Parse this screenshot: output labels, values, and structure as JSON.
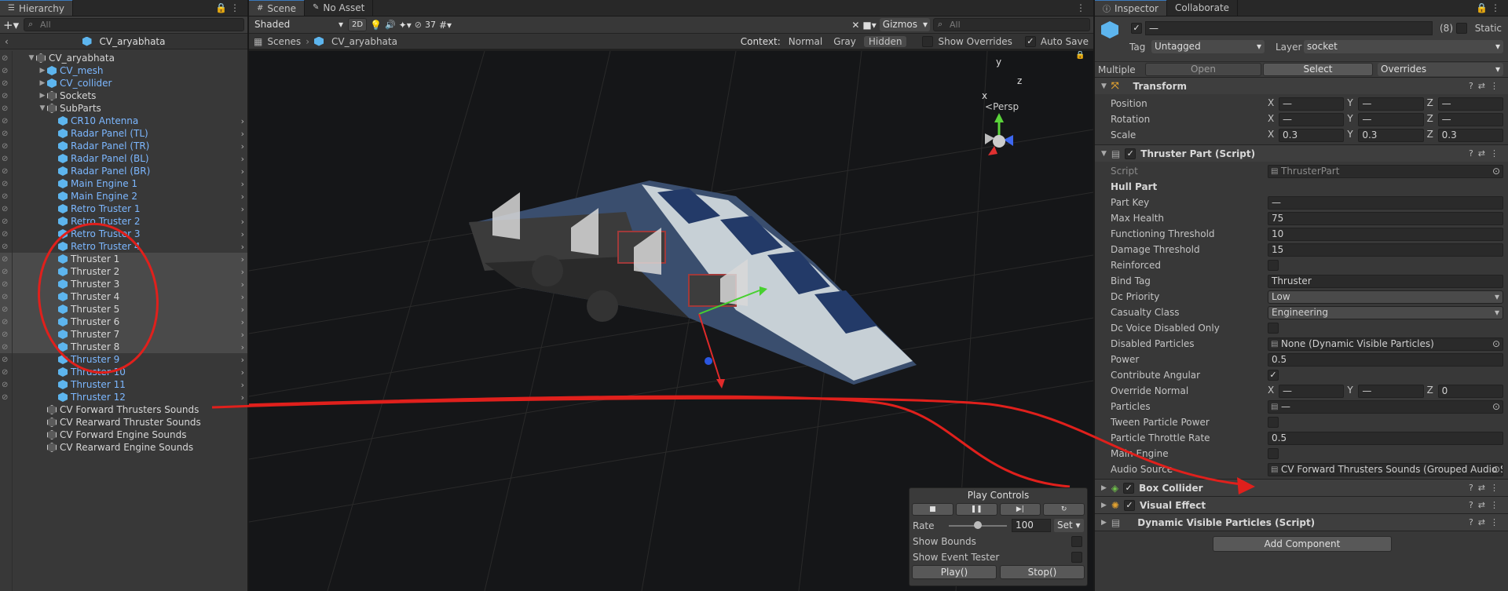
{
  "hierarchy": {
    "tab_label": "Hierarchy",
    "search_placeholder": "All",
    "scene_title": "CV_aryabhata",
    "rows": [
      {
        "indent": 0,
        "label": "CV_aryabhata",
        "expanded": true,
        "color": "white",
        "cube": "gray",
        "chevron": false
      },
      {
        "indent": 1,
        "label": "CV_mesh",
        "expanded": false,
        "color": "blue",
        "cube": "blue",
        "chevron": false
      },
      {
        "indent": 1,
        "label": "CV_collider",
        "expanded": false,
        "color": "blue",
        "cube": "blue",
        "chevron": false
      },
      {
        "indent": 1,
        "label": "Sockets",
        "expanded": false,
        "color": "white",
        "cube": "gray",
        "chevron": false
      },
      {
        "indent": 1,
        "label": "SubParts",
        "expanded": true,
        "color": "white",
        "cube": "gray",
        "chevron": false
      },
      {
        "indent": 2,
        "label": "CR10 Antenna",
        "color": "blue",
        "cube": "blue",
        "chevron": true
      },
      {
        "indent": 2,
        "label": "Radar Panel (TL)",
        "color": "blue",
        "cube": "blue",
        "chevron": true
      },
      {
        "indent": 2,
        "label": "Radar Panel (TR)",
        "color": "blue",
        "cube": "blue",
        "chevron": true
      },
      {
        "indent": 2,
        "label": "Radar Panel (BL)",
        "color": "blue",
        "cube": "blue",
        "chevron": true
      },
      {
        "indent": 2,
        "label": "Radar Panel (BR)",
        "color": "blue",
        "cube": "blue",
        "chevron": true
      },
      {
        "indent": 2,
        "label": "Main Engine 1",
        "color": "blue",
        "cube": "blue",
        "chevron": true
      },
      {
        "indent": 2,
        "label": "Main Engine 2",
        "color": "blue",
        "cube": "blue",
        "chevron": true
      },
      {
        "indent": 2,
        "label": "Retro Truster 1",
        "color": "blue",
        "cube": "blue",
        "chevron": true
      },
      {
        "indent": 2,
        "label": "Retro Truster 2",
        "color": "blue",
        "cube": "blue",
        "chevron": true
      },
      {
        "indent": 2,
        "label": "Retro Truster 3",
        "color": "blue",
        "cube": "blue",
        "chevron": true
      },
      {
        "indent": 2,
        "label": "Retro Truster 4",
        "color": "blue",
        "cube": "blue",
        "chevron": true
      },
      {
        "indent": 2,
        "label": "Thruster 1",
        "color": "white",
        "cube": "blue",
        "chevron": true,
        "selected": true
      },
      {
        "indent": 2,
        "label": "Thruster 2",
        "color": "white",
        "cube": "blue",
        "chevron": true,
        "selected": true
      },
      {
        "indent": 2,
        "label": "Thruster 3",
        "color": "white",
        "cube": "blue",
        "chevron": true,
        "selected": true
      },
      {
        "indent": 2,
        "label": "Thruster 4",
        "color": "white",
        "cube": "blue",
        "chevron": true,
        "selected": true
      },
      {
        "indent": 2,
        "label": "Thruster 5",
        "color": "white",
        "cube": "blue",
        "chevron": true,
        "selected": true
      },
      {
        "indent": 2,
        "label": "Thruster 6",
        "color": "white",
        "cube": "blue",
        "chevron": true,
        "selected": true
      },
      {
        "indent": 2,
        "label": "Thruster 7",
        "color": "white",
        "cube": "blue",
        "chevron": true,
        "selected": true
      },
      {
        "indent": 2,
        "label": "Thruster 8",
        "color": "white",
        "cube": "blue",
        "chevron": true,
        "selected": true
      },
      {
        "indent": 2,
        "label": "Thruster 9",
        "color": "blue",
        "cube": "blue",
        "chevron": true
      },
      {
        "indent": 2,
        "label": "Thruster 10",
        "color": "blue",
        "cube": "blue",
        "chevron": true
      },
      {
        "indent": 2,
        "label": "Thruster 11",
        "color": "blue",
        "cube": "blue",
        "chevron": true
      },
      {
        "indent": 2,
        "label": "Thruster 12",
        "color": "blue",
        "cube": "blue",
        "chevron": true
      },
      {
        "indent": 1,
        "label": "CV Forward Thrusters Sounds",
        "color": "white",
        "cube": "gray",
        "chevron": false,
        "noeye": true
      },
      {
        "indent": 1,
        "label": "CV Rearward Thruster Sounds",
        "color": "white",
        "cube": "gray",
        "chevron": false,
        "noeye": true
      },
      {
        "indent": 1,
        "label": "CV Forward Engine Sounds",
        "color": "white",
        "cube": "gray",
        "chevron": false,
        "noeye": true
      },
      {
        "indent": 1,
        "label": "CV Rearward Engine Sounds",
        "color": "white",
        "cube": "gray",
        "chevron": false,
        "noeye": true
      }
    ]
  },
  "scene": {
    "tab_scene": "Scene",
    "tab_asset": "No Asset",
    "shading": "Shaded",
    "mode_2d": "2D",
    "hidden_count": "37",
    "gizmos": "Gizmos",
    "search_placeholder": "All",
    "crumb_root": "Scenes",
    "crumb_current": "CV_aryabhata",
    "context_label": "Context:",
    "ctx_normal": "Normal",
    "ctx_gray": "Gray",
    "ctx_hidden": "Hidden",
    "show_overrides": "Show Overrides",
    "auto_save": "Auto Save",
    "persp": "Persp",
    "axis_x": "x",
    "axis_y": "y",
    "axis_z": "z",
    "play_controls": {
      "title": "Play Controls",
      "rate_label": "Rate",
      "rate_value": "100",
      "set_label": "Set",
      "rate_fraction": 0.5,
      "show_bounds": "Show Bounds",
      "show_event_tester": "Show Event Tester",
      "play_btn": "Play()",
      "stop_btn": "Stop()"
    }
  },
  "inspector": {
    "tab_inspector": "Inspector",
    "tab_collaborate": "Collaborate",
    "name_value": "—",
    "count": "(8)",
    "static_label": "Static",
    "tag_label": "Tag",
    "tag_value": "Untagged",
    "layer_label": "Layer",
    "layer_value": "socket",
    "multiple_label": "Multiple",
    "open_btn": "Open",
    "select_btn": "Select",
    "overrides_label": "Overrides",
    "transform": {
      "title": "Transform",
      "position_label": "Position",
      "rotation_label": "Rotation",
      "scale_label": "Scale",
      "position": [
        "—",
        "—",
        "—"
      ],
      "rotation": [
        "—",
        "—",
        "—"
      ],
      "scale": [
        "0.3",
        "0.3",
        "0.3"
      ]
    },
    "thruster": {
      "title": "Thruster Part (Script)",
      "script_label": "Script",
      "script_value": "ThrusterPart",
      "section": "Hull Part",
      "part_key_label": "Part Key",
      "part_key": "—",
      "max_health_label": "Max Health",
      "max_health": "75",
      "functioning_label": "Functioning Threshold",
      "functioning": "10",
      "damage_label": "Damage Threshold",
      "damage": "15",
      "reinforced_label": "Reinforced",
      "bind_tag_label": "Bind Tag",
      "bind_tag": "Thruster",
      "dc_priority_label": "Dc Priority",
      "dc_priority": "Low",
      "casualty_label": "Casualty Class",
      "casualty": "Engineering",
      "dc_voice_label": "Dc Voice Disabled Only",
      "disabled_particles_label": "Disabled Particles",
      "disabled_particles": "None (Dynamic Visible Particles)",
      "power_label": "Power",
      "power": "0.5",
      "contribute_label": "Contribute Angular",
      "override_label": "Override Normal",
      "override": [
        "—",
        "—",
        "0"
      ],
      "particles_label": "Particles",
      "particles": "—",
      "tween_label": "Tween Particle Power",
      "throttle_label": "Particle Throttle Rate",
      "throttle": "0.5",
      "main_engine_label": "Main Engine",
      "audio_label": "Audio Source",
      "audio": "CV Forward Thrusters Sounds (Grouped Audio So"
    },
    "box_collider": "Box Collider",
    "visual_effect": "Visual Effect",
    "dynamic_particles": "Dynamic Visible Particles (Script)",
    "add_component": "Add Component"
  },
  "colors": {
    "accent": "#3a79bb",
    "annotation": "#e0201c",
    "prefab_blue": "#7cb7ff"
  }
}
